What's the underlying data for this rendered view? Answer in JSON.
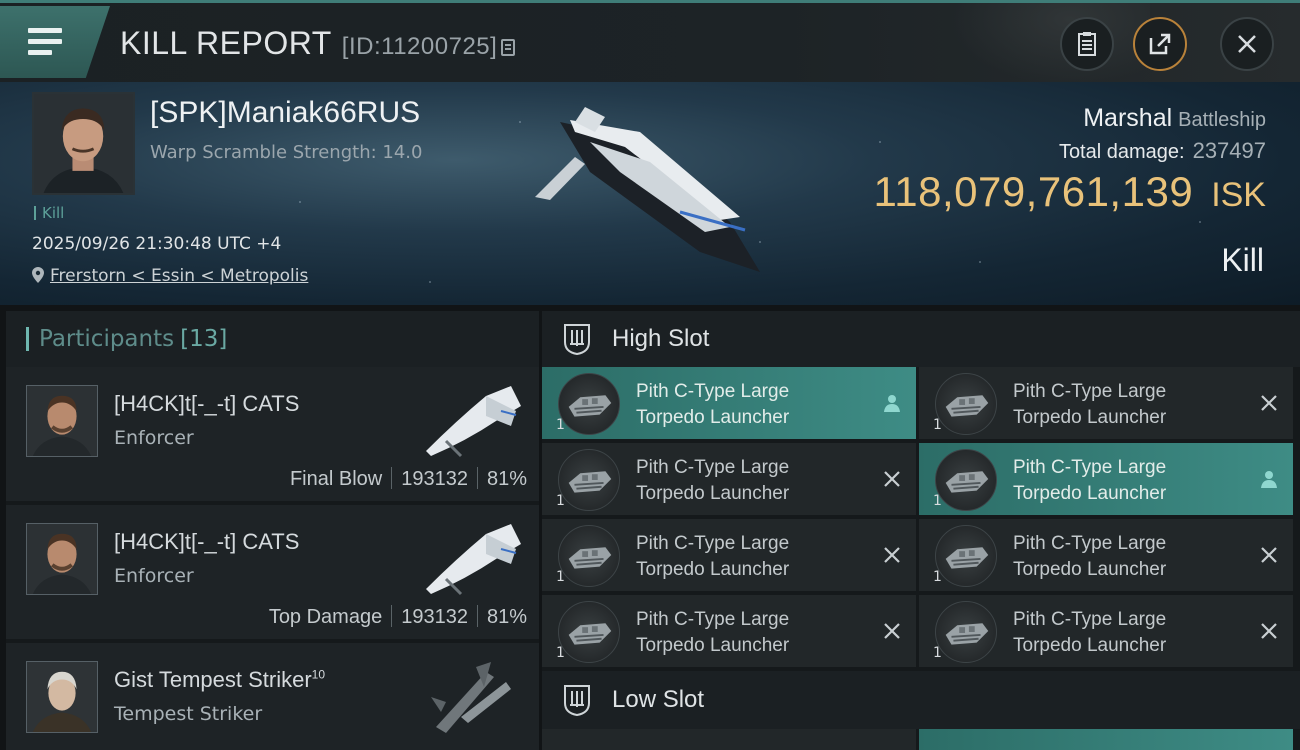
{
  "header": {
    "title": "KILL REPORT",
    "report_id": "[ID:11200725]"
  },
  "victim": {
    "name": "[SPK]Maniak66RUS",
    "scramble": "Warp Scramble Strength: 14.0",
    "tag": "Kill",
    "datetime": "2025/09/26 21:30:48 UTC +4",
    "location": "Frerstorn < Essin < Metropolis",
    "ship_name": "Marshal",
    "ship_type": "Battleship",
    "total_damage_label": "Total damage:",
    "total_damage": "237497",
    "isk_value": "118,079,761,139",
    "isk_unit": "ISK",
    "outcome": "Kill"
  },
  "participants": {
    "label": "Participants",
    "count": "[13]",
    "rows": [
      {
        "name": "[H4CK]t[-_-t] CATS",
        "ship": "Enforcer",
        "role": "Final Blow",
        "damage": "193132",
        "percent": "81%"
      },
      {
        "name": "[H4CK]t[-_-t] CATS",
        "ship": "Enforcer",
        "role": "Top Damage",
        "damage": "193132",
        "percent": "81%"
      },
      {
        "name": "Gist Tempest Striker",
        "level": "10",
        "ship": "Tempest Striker"
      }
    ]
  },
  "slots": {
    "high": {
      "title": "High Slot",
      "items": [
        {
          "line1": "Pith C-Type Large",
          "line2": "Torpedo Launcher",
          "qty": "1",
          "status": "dropped"
        },
        {
          "line1": "Pith C-Type Large",
          "line2": "Torpedo Launcher",
          "qty": "1",
          "status": "destroyed"
        },
        {
          "line1": "Pith C-Type Large",
          "line2": "Torpedo Launcher",
          "qty": "1",
          "status": "destroyed"
        },
        {
          "line1": "Pith C-Type Large",
          "line2": "Torpedo Launcher",
          "qty": "1",
          "status": "dropped"
        },
        {
          "line1": "Pith C-Type Large",
          "line2": "Torpedo Launcher",
          "qty": "1",
          "status": "destroyed"
        },
        {
          "line1": "Pith C-Type Large",
          "line2": "Torpedo Launcher",
          "qty": "1",
          "status": "destroyed"
        },
        {
          "line1": "Pith C-Type Large",
          "line2": "Torpedo Launcher",
          "qty": "1",
          "status": "destroyed"
        },
        {
          "line1": "Pith C-Type Large",
          "line2": "Torpedo Launcher",
          "qty": "1",
          "status": "destroyed"
        }
      ]
    },
    "low": {
      "title": "Low Slot"
    }
  },
  "colors": {
    "accent": "#3e8c85",
    "isk": "#e9c27a",
    "header_bar": "#3f7d78"
  }
}
